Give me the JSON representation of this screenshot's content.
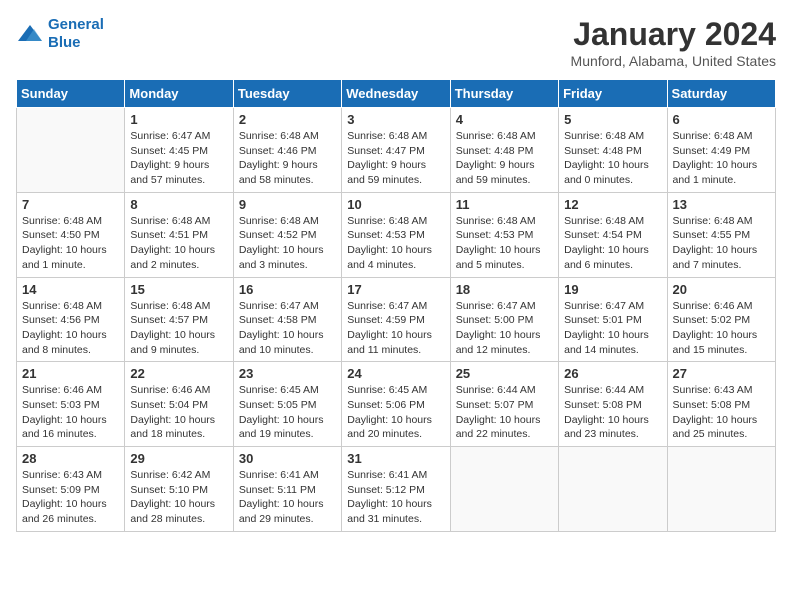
{
  "header": {
    "logo_line1": "General",
    "logo_line2": "Blue",
    "title": "January 2024",
    "subtitle": "Munford, Alabama, United States"
  },
  "weekdays": [
    "Sunday",
    "Monday",
    "Tuesday",
    "Wednesday",
    "Thursday",
    "Friday",
    "Saturday"
  ],
  "weeks": [
    [
      {
        "day": "",
        "info": ""
      },
      {
        "day": "1",
        "info": "Sunrise: 6:47 AM\nSunset: 4:45 PM\nDaylight: 9 hours\nand 57 minutes."
      },
      {
        "day": "2",
        "info": "Sunrise: 6:48 AM\nSunset: 4:46 PM\nDaylight: 9 hours\nand 58 minutes."
      },
      {
        "day": "3",
        "info": "Sunrise: 6:48 AM\nSunset: 4:47 PM\nDaylight: 9 hours\nand 59 minutes."
      },
      {
        "day": "4",
        "info": "Sunrise: 6:48 AM\nSunset: 4:48 PM\nDaylight: 9 hours\nand 59 minutes."
      },
      {
        "day": "5",
        "info": "Sunrise: 6:48 AM\nSunset: 4:48 PM\nDaylight: 10 hours\nand 0 minutes."
      },
      {
        "day": "6",
        "info": "Sunrise: 6:48 AM\nSunset: 4:49 PM\nDaylight: 10 hours\nand 1 minute."
      }
    ],
    [
      {
        "day": "7",
        "info": "Sunrise: 6:48 AM\nSunset: 4:50 PM\nDaylight: 10 hours\nand 1 minute."
      },
      {
        "day": "8",
        "info": "Sunrise: 6:48 AM\nSunset: 4:51 PM\nDaylight: 10 hours\nand 2 minutes."
      },
      {
        "day": "9",
        "info": "Sunrise: 6:48 AM\nSunset: 4:52 PM\nDaylight: 10 hours\nand 3 minutes."
      },
      {
        "day": "10",
        "info": "Sunrise: 6:48 AM\nSunset: 4:53 PM\nDaylight: 10 hours\nand 4 minutes."
      },
      {
        "day": "11",
        "info": "Sunrise: 6:48 AM\nSunset: 4:53 PM\nDaylight: 10 hours\nand 5 minutes."
      },
      {
        "day": "12",
        "info": "Sunrise: 6:48 AM\nSunset: 4:54 PM\nDaylight: 10 hours\nand 6 minutes."
      },
      {
        "day": "13",
        "info": "Sunrise: 6:48 AM\nSunset: 4:55 PM\nDaylight: 10 hours\nand 7 minutes."
      }
    ],
    [
      {
        "day": "14",
        "info": "Sunrise: 6:48 AM\nSunset: 4:56 PM\nDaylight: 10 hours\nand 8 minutes."
      },
      {
        "day": "15",
        "info": "Sunrise: 6:48 AM\nSunset: 4:57 PM\nDaylight: 10 hours\nand 9 minutes."
      },
      {
        "day": "16",
        "info": "Sunrise: 6:47 AM\nSunset: 4:58 PM\nDaylight: 10 hours\nand 10 minutes."
      },
      {
        "day": "17",
        "info": "Sunrise: 6:47 AM\nSunset: 4:59 PM\nDaylight: 10 hours\nand 11 minutes."
      },
      {
        "day": "18",
        "info": "Sunrise: 6:47 AM\nSunset: 5:00 PM\nDaylight: 10 hours\nand 12 minutes."
      },
      {
        "day": "19",
        "info": "Sunrise: 6:47 AM\nSunset: 5:01 PM\nDaylight: 10 hours\nand 14 minutes."
      },
      {
        "day": "20",
        "info": "Sunrise: 6:46 AM\nSunset: 5:02 PM\nDaylight: 10 hours\nand 15 minutes."
      }
    ],
    [
      {
        "day": "21",
        "info": "Sunrise: 6:46 AM\nSunset: 5:03 PM\nDaylight: 10 hours\nand 16 minutes."
      },
      {
        "day": "22",
        "info": "Sunrise: 6:46 AM\nSunset: 5:04 PM\nDaylight: 10 hours\nand 18 minutes."
      },
      {
        "day": "23",
        "info": "Sunrise: 6:45 AM\nSunset: 5:05 PM\nDaylight: 10 hours\nand 19 minutes."
      },
      {
        "day": "24",
        "info": "Sunrise: 6:45 AM\nSunset: 5:06 PM\nDaylight: 10 hours\nand 20 minutes."
      },
      {
        "day": "25",
        "info": "Sunrise: 6:44 AM\nSunset: 5:07 PM\nDaylight: 10 hours\nand 22 minutes."
      },
      {
        "day": "26",
        "info": "Sunrise: 6:44 AM\nSunset: 5:08 PM\nDaylight: 10 hours\nand 23 minutes."
      },
      {
        "day": "27",
        "info": "Sunrise: 6:43 AM\nSunset: 5:08 PM\nDaylight: 10 hours\nand 25 minutes."
      }
    ],
    [
      {
        "day": "28",
        "info": "Sunrise: 6:43 AM\nSunset: 5:09 PM\nDaylight: 10 hours\nand 26 minutes."
      },
      {
        "day": "29",
        "info": "Sunrise: 6:42 AM\nSunset: 5:10 PM\nDaylight: 10 hours\nand 28 minutes."
      },
      {
        "day": "30",
        "info": "Sunrise: 6:41 AM\nSunset: 5:11 PM\nDaylight: 10 hours\nand 29 minutes."
      },
      {
        "day": "31",
        "info": "Sunrise: 6:41 AM\nSunset: 5:12 PM\nDaylight: 10 hours\nand 31 minutes."
      },
      {
        "day": "",
        "info": ""
      },
      {
        "day": "",
        "info": ""
      },
      {
        "day": "",
        "info": ""
      }
    ]
  ]
}
